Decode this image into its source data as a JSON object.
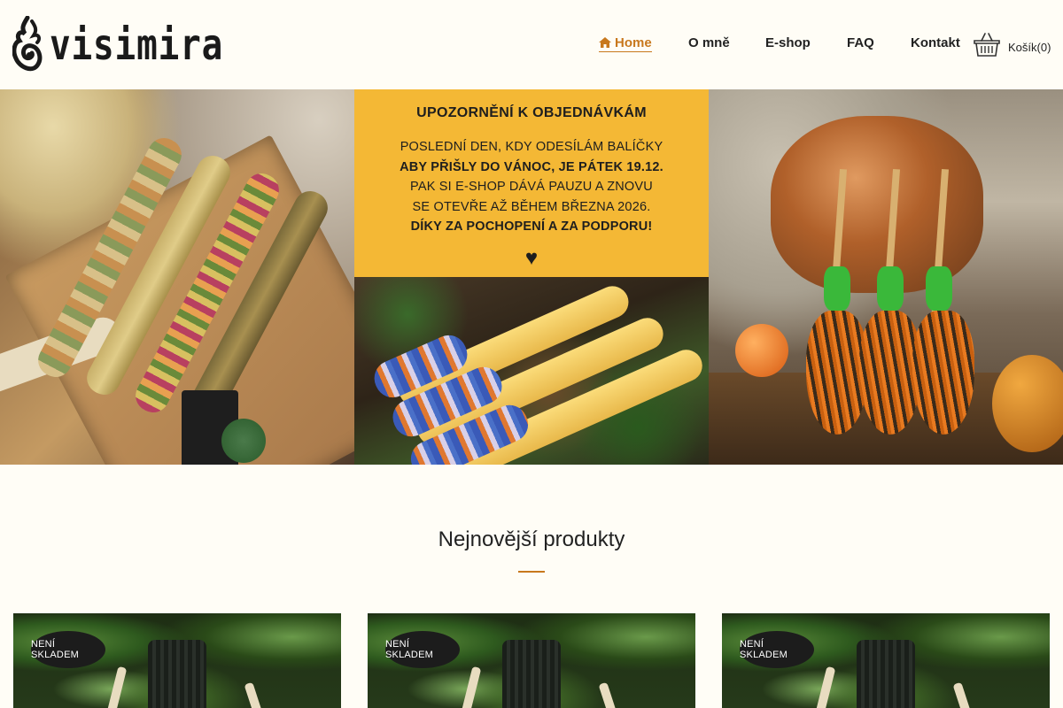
{
  "brand": {
    "name": "visimira"
  },
  "nav": [
    {
      "label": "Home",
      "active": true
    },
    {
      "label": "O mně"
    },
    {
      "label": "E-shop"
    },
    {
      "label": "FAQ"
    },
    {
      "label": "Kontakt"
    }
  ],
  "cart": {
    "label": "Košík(0)"
  },
  "colors": {
    "accent": "#c8781d",
    "background": "#fffdf6",
    "notice_bg": "#f4b835"
  },
  "hero": {
    "notice": {
      "title": "UPOZORNĚNÍ K OBJEDNÁVKÁM",
      "lines": [
        "POSLEDNÍ DEN, KDY ODESÍLÁM BALÍČKY",
        "ABY PŘIŠLY DO VÁNOC, JE PÁTEK 19.12.",
        "PAK SI E-SHOP DÁVÁ PAUZU A ZNOVU",
        "SE OTEVŘE AŽ BĚHEM BŘEZNA 2026.",
        "DÍKY ZA POCHOPENÍ A ZA PODPORU!"
      ],
      "heart": "♥"
    }
  },
  "section": {
    "title": "Nejnovější produkty"
  },
  "products": [
    {
      "badge": "NENÍ SKLADEM"
    },
    {
      "badge": "NENÍ SKLADEM"
    },
    {
      "badge": "NENÍ SKLADEM"
    }
  ]
}
